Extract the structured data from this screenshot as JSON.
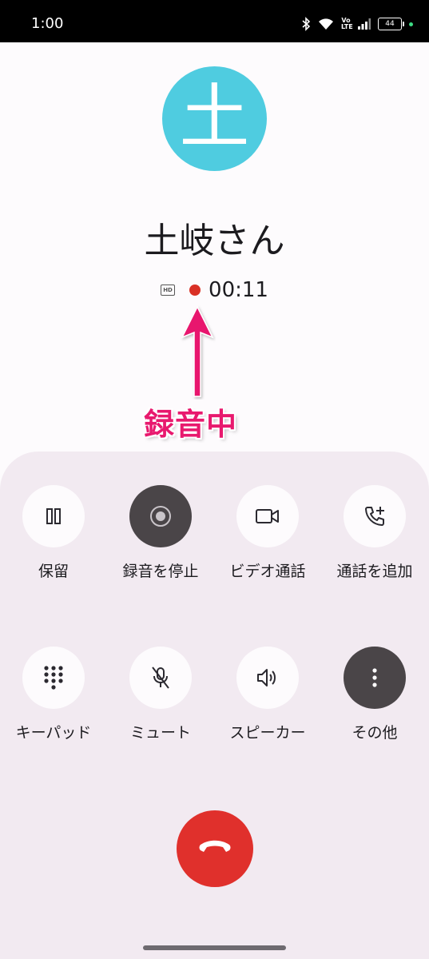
{
  "status_bar": {
    "time": "1:00",
    "volte_label": "Vo LTE",
    "battery_level": "44",
    "icons": [
      "bluetooth-icon",
      "wifi-icon",
      "volte-icon",
      "signal-icon",
      "battery-icon"
    ]
  },
  "caller": {
    "avatar_initial": "土",
    "avatar_color": "#4fcce0",
    "name": "土岐さん",
    "hd_label": "HD",
    "call_duration": "00:11",
    "recording_dot_color": "#d93025"
  },
  "annotation": {
    "label": "録音中",
    "color": "#e8196e"
  },
  "controls": {
    "row1": [
      {
        "label": "保留",
        "icon": "pause-icon"
      },
      {
        "label": "録音を停止",
        "icon": "record-icon"
      },
      {
        "label": "ビデオ通話",
        "icon": "video-icon"
      },
      {
        "label": "通話を追加",
        "icon": "add-call-icon"
      }
    ],
    "row2": [
      {
        "label": "キーパッド",
        "icon": "keypad-icon"
      },
      {
        "label": "ミュート",
        "icon": "mic-off-icon"
      },
      {
        "label": "スピーカー",
        "icon": "speaker-icon"
      },
      {
        "label": "その他",
        "icon": "more-vert-icon"
      }
    ]
  },
  "end_call": {
    "icon": "end-call-icon",
    "color": "#e0302c"
  }
}
